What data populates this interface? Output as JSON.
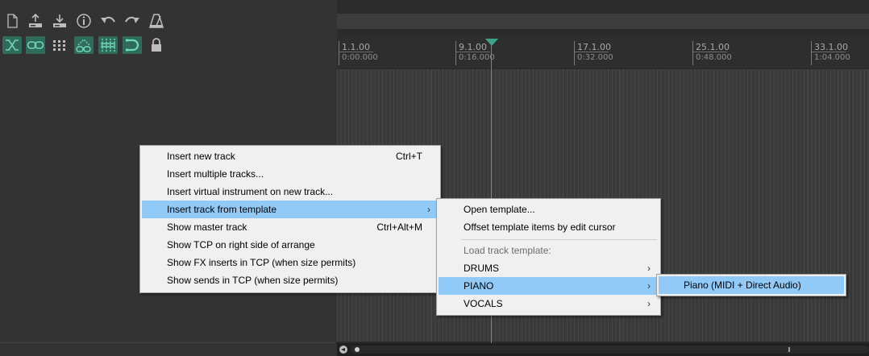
{
  "toolbar": {
    "row1": [
      {
        "name": "new-project-icon",
        "active": false
      },
      {
        "name": "open-project-icon",
        "active": false
      },
      {
        "name": "save-project-icon",
        "active": false
      },
      {
        "name": "project-info-icon",
        "active": false
      },
      {
        "name": "undo-icon",
        "active": false
      },
      {
        "name": "redo-icon",
        "active": false
      },
      {
        "name": "metronome-icon",
        "active": false
      }
    ],
    "row2": [
      {
        "name": "ripple-edit-icon",
        "active": true
      },
      {
        "name": "group-link-icon",
        "active": true
      },
      {
        "name": "grid-icon",
        "active": false
      },
      {
        "name": "envelope-link-icon",
        "active": true
      },
      {
        "name": "snap-icon",
        "active": true
      },
      {
        "name": "loop-points-icon",
        "active": true
      },
      {
        "name": "lock-icon",
        "active": false
      }
    ],
    "accent_color": "#2f6a5a"
  },
  "ruler": {
    "marks": [
      {
        "bar": "1.1.00",
        "time": "0:00.000"
      },
      {
        "bar": "9.1.00",
        "time": "0:16.000"
      },
      {
        "bar": "17.1.00",
        "time": "0:32.000"
      },
      {
        "bar": "25.1.00",
        "time": "0:48.000"
      },
      {
        "bar": "33.1.00",
        "time": "1:04.000"
      }
    ],
    "cursor_color": "#3fa38a"
  },
  "context_menu": {
    "items": [
      {
        "label": "Insert new track",
        "shortcut": "Ctrl+T",
        "submenu": false,
        "highlighted": false
      },
      {
        "label": "Insert multiple tracks...",
        "shortcut": "",
        "submenu": false,
        "highlighted": false
      },
      {
        "label": "Insert virtual instrument on new track...",
        "shortcut": "",
        "submenu": false,
        "highlighted": false
      },
      {
        "label": "Insert track from template",
        "shortcut": "",
        "submenu": true,
        "highlighted": true
      },
      {
        "label": "Show master track",
        "shortcut": "Ctrl+Alt+M",
        "submenu": false,
        "highlighted": false
      },
      {
        "label": "Show TCP on right side of arrange",
        "shortcut": "",
        "submenu": false,
        "highlighted": false
      },
      {
        "label": "Show FX inserts in TCP (when size permits)",
        "shortcut": "",
        "submenu": false,
        "highlighted": false
      },
      {
        "label": "Show sends in TCP (when size permits)",
        "shortcut": "",
        "submenu": false,
        "highlighted": false
      }
    ]
  },
  "template_submenu": {
    "open_template": "Open template...",
    "offset_items": "Offset template items by edit cursor",
    "load_header": "Load track template:",
    "folders": [
      {
        "label": "DRUMS",
        "highlighted": false
      },
      {
        "label": "PIANO",
        "highlighted": true
      },
      {
        "label": "VOCALS",
        "highlighted": false
      }
    ]
  },
  "piano_submenu": {
    "items": [
      {
        "label": "Piano (MIDI + Direct Audio)",
        "highlighted": true
      }
    ]
  },
  "highlight_color": "#91c9f7"
}
